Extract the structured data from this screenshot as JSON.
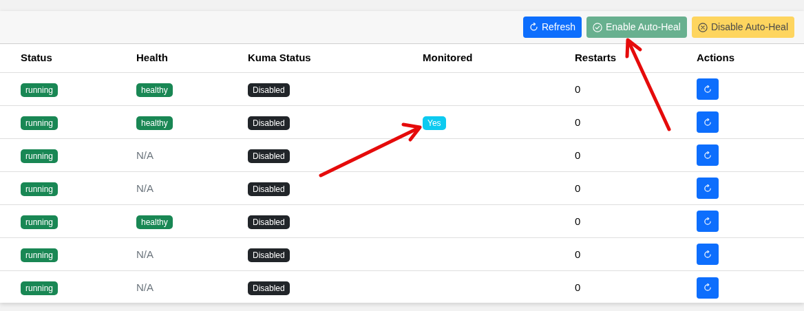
{
  "toolbar": {
    "buttons": [
      {
        "label": "Refresh",
        "kind": "refresh"
      },
      {
        "label": "Enable Auto-Heal",
        "kind": "enable"
      },
      {
        "label": "Disable Auto-Heal",
        "kind": "disable"
      }
    ]
  },
  "table": {
    "columns": [
      "Status",
      "Health",
      "Kuma Status",
      "Monitored",
      "Restarts",
      "Actions"
    ],
    "rows": [
      {
        "status": "running",
        "health": {
          "text": "healthy",
          "kind": "badge"
        },
        "kuma_status": "Disabled",
        "restarts": "0"
      },
      {
        "status": "running",
        "health": {
          "text": "healthy",
          "kind": "badge"
        },
        "kuma_status": "Disabled",
        "monitored": "Yes",
        "restarts": "0"
      },
      {
        "status": "running",
        "health": {
          "text": "N/A",
          "kind": "text"
        },
        "kuma_status": "Disabled",
        "restarts": "0"
      },
      {
        "status": "running",
        "health": {
          "text": "N/A",
          "kind": "text"
        },
        "kuma_status": "Disabled",
        "restarts": "0"
      },
      {
        "status": "running",
        "health": {
          "text": "healthy",
          "kind": "badge"
        },
        "kuma_status": "Disabled",
        "restarts": "0"
      },
      {
        "status": "running",
        "health": {
          "text": "N/A",
          "kind": "text"
        },
        "kuma_status": "Disabled",
        "restarts": "0"
      },
      {
        "status": "running",
        "health": {
          "text": "N/A",
          "kind": "text"
        },
        "kuma_status": "Disabled",
        "restarts": "0"
      }
    ]
  }
}
